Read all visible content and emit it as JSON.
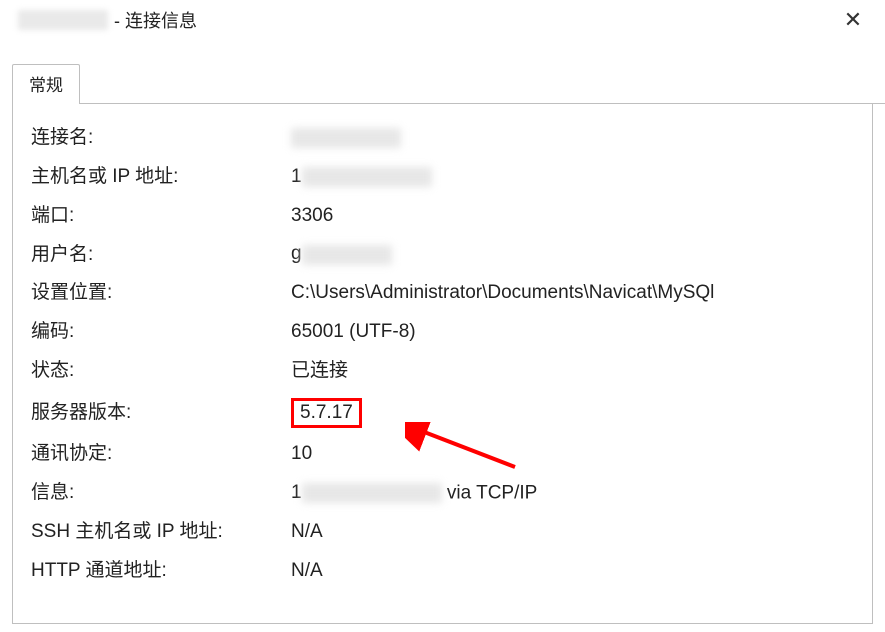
{
  "window": {
    "title_suffix": "- 连接信息",
    "close_glyph": "✕"
  },
  "tabs": {
    "general": "常规"
  },
  "fields": {
    "conn_name": {
      "label": "连接名:"
    },
    "host": {
      "label": "主机名或 IP 地址:",
      "value_prefix": "1"
    },
    "port": {
      "label": "端口:",
      "value": "3306"
    },
    "user": {
      "label": "用户名:",
      "value_prefix": "g"
    },
    "settings": {
      "label": "设置位置:",
      "value": "C:\\Users\\Administrator\\Documents\\Navicat\\MySQl"
    },
    "encoding": {
      "label": "编码:",
      "value": "65001 (UTF-8)"
    },
    "status": {
      "label": "状态:",
      "value": "已连接"
    },
    "server_ver": {
      "label": "服务器版本:",
      "value": "5.7.17"
    },
    "protocol": {
      "label": "通讯协定:",
      "value": "10"
    },
    "info": {
      "label": "信息:",
      "value_prefix": "1",
      "value_suffix": "via TCP/IP"
    },
    "ssh_host": {
      "label": "SSH 主机名或 IP 地址:",
      "value": "N/A"
    },
    "http_tunnel": {
      "label": "HTTP 通道地址:",
      "value": "N/A"
    }
  },
  "annotation": {
    "highlight_color": "#ff0000"
  }
}
